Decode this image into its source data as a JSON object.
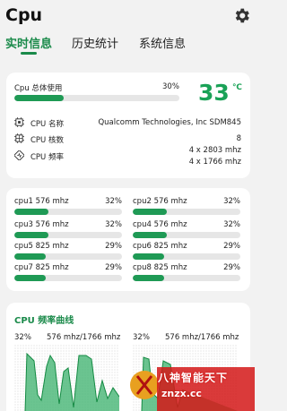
{
  "app": {
    "title": "Cpu"
  },
  "tabs": [
    {
      "label": "实时信息",
      "active": true
    },
    {
      "label": "历史统计",
      "active": false
    },
    {
      "label": "系统信息",
      "active": false
    }
  ],
  "summary": {
    "usage_label": "Cpu 总体使用",
    "usage_percent": "30%",
    "usage_fraction": 0.3,
    "temperature": "33",
    "temperature_unit": "℃"
  },
  "info": [
    {
      "label": "CPU 名称",
      "value": "Qualcomm Technologies, Inc SDM845",
      "icon": "cpu-chip-icon"
    },
    {
      "label": "CPU 核数",
      "value": "8",
      "icon": "cpu-core-icon"
    },
    {
      "label": "CPU 频率",
      "value": "4 x 2803 mhz",
      "value2": "4 x 1766 mhz",
      "icon": "frequency-icon"
    }
  ],
  "cores": [
    {
      "name": "cpu1",
      "freq": "576 mhz",
      "pct": "32%",
      "fraction": 0.32
    },
    {
      "name": "cpu2",
      "freq": "576 mhz",
      "pct": "32%",
      "fraction": 0.32
    },
    {
      "name": "cpu3",
      "freq": "576 mhz",
      "pct": "32%",
      "fraction": 0.32
    },
    {
      "name": "cpu4",
      "freq": "576 mhz",
      "pct": "32%",
      "fraction": 0.32
    },
    {
      "name": "cpu5",
      "freq": "825 mhz",
      "pct": "29%",
      "fraction": 0.29
    },
    {
      "name": "cpu6",
      "freq": "825 mhz",
      "pct": "29%",
      "fraction": 0.29
    },
    {
      "name": "cpu7",
      "freq": "825 mhz",
      "pct": "29%",
      "fraction": 0.29
    },
    {
      "name": "cpu8",
      "freq": "825 mhz",
      "pct": "29%",
      "fraction": 0.29
    }
  ],
  "freq_section": {
    "title": "CPU 频率曲线",
    "graphs": [
      {
        "pct": "32%",
        "freq": "576 mhz/1766 mhz"
      },
      {
        "pct": "32%",
        "freq": "576 mhz/1766 mhz"
      }
    ]
  },
  "watermark": {
    "line1": "八神智能天下",
    "line2": "znzx.cc"
  },
  "colors": {
    "accent": "#1a8a4a",
    "bar": "#1f9a55",
    "temp": "#1aa257"
  }
}
